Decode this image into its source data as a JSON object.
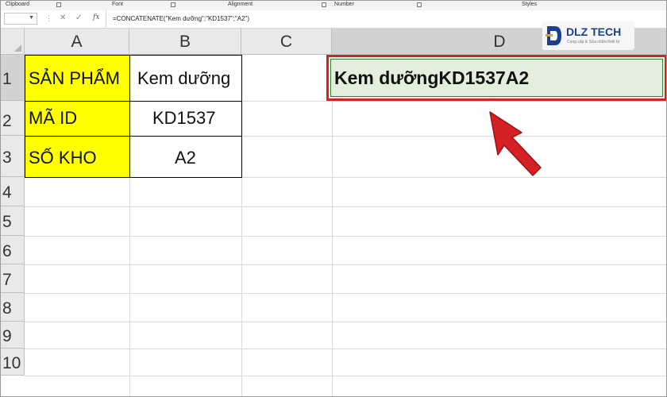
{
  "ribbon": {
    "groups": [
      "Clipboard",
      "Font",
      "Alignment",
      "Number",
      "Styles"
    ]
  },
  "formula_bar": {
    "fx_label": "fx",
    "formula": "=CONCATENATE(\"Kem dưỡng\";\"KD1537\";\"A2\")"
  },
  "columns": [
    "A",
    "B",
    "C",
    "D"
  ],
  "rows": [
    "1",
    "2",
    "3",
    "4",
    "5",
    "6",
    "7",
    "8",
    "9",
    "10"
  ],
  "cells": {
    "A1": "SẢN PHẨM",
    "B1": "Kem dưỡng",
    "A2": "MÃ ID",
    "B2": "KD1537",
    "A3": "SỐ KHO",
    "B3": "A2",
    "D1": "Kem dưỡngKD1537A2"
  },
  "logo": {
    "brand": "DLZ TECH",
    "tagline": "Cung cấp & Sửa chữa thiết bị"
  },
  "colors": {
    "highlight_yellow": "#ffff00",
    "selected_cell_fill": "#e3efdc",
    "callout_red": "#d32126",
    "logo_blue": "#1c3f8f"
  },
  "icons": [
    "cancel-icon",
    "enter-icon",
    "function-icon",
    "arrow-pointer-icon"
  ]
}
